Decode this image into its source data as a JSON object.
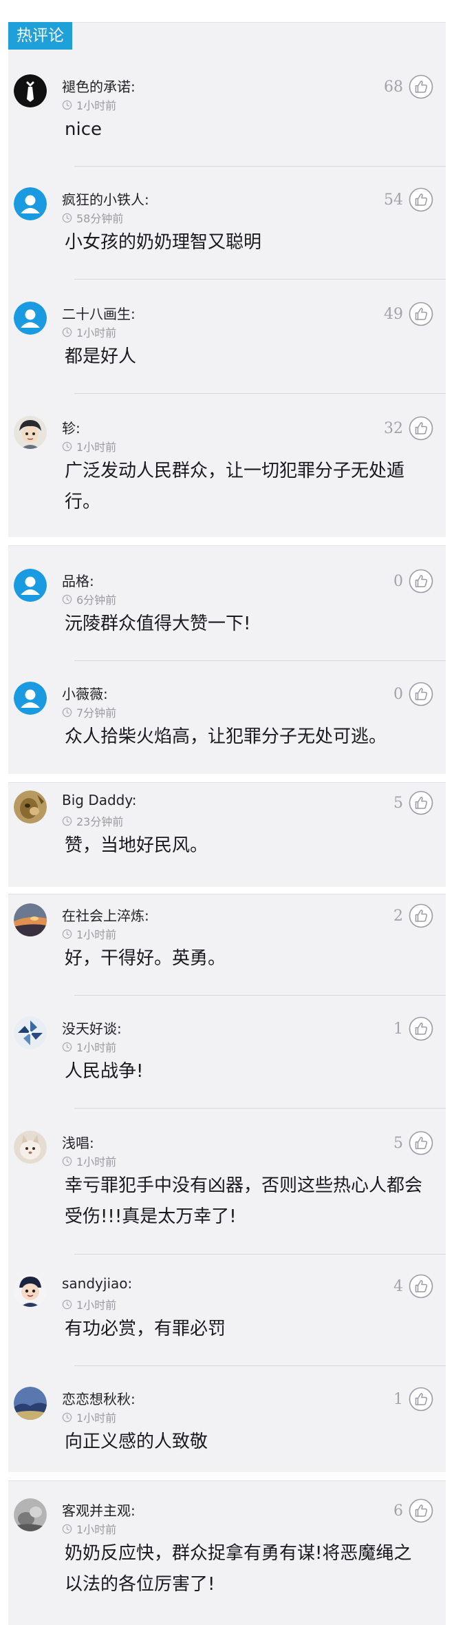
{
  "section": {
    "title": "热评论"
  },
  "comments": [
    {
      "username": "褪色的承诺:",
      "time": "1小时前",
      "likes": "68",
      "content": "nice",
      "avatar": "white-tie-avatar",
      "avatar_color": "#111111"
    },
    {
      "username": "疯狂的小铁人:",
      "time": "58分钟前",
      "likes": "54",
      "content": "小女孩的奶奶理智又聪明",
      "avatar": "default-user-avatar",
      "avatar_color": "#1a9ae0"
    },
    {
      "username": "二十八画生:",
      "time": "1小时前",
      "likes": "49",
      "content": "都是好人",
      "avatar": "default-user-avatar",
      "avatar_color": "#1a9ae0"
    },
    {
      "username": "轸:",
      "time": "1小时前",
      "likes": "32",
      "content": "广泛发动人民群众，让一切犯罪分子无处遁行。",
      "avatar": "cartoon-boy-avatar",
      "avatar_color": "#4a5060"
    },
    {
      "username": "品格:",
      "time": "6分钟前",
      "likes": "0",
      "content": "沅陵群众值得大赞一下!",
      "avatar": "default-user-avatar",
      "avatar_color": "#1a9ae0"
    },
    {
      "username": "小薇薇:",
      "time": "7分钟前",
      "likes": "0",
      "content": "众人拾柴火焰高，让犯罪分子无处可逃。",
      "avatar": "default-user-avatar",
      "avatar_color": "#1a9ae0"
    },
    {
      "username": "Big Daddy:",
      "time": "23分钟前",
      "likes": "5",
      "content": "赞，当地好民风。",
      "avatar": "animal-photo-avatar",
      "avatar_color": "#8a6a30"
    },
    {
      "username": "在社会上淬炼:",
      "time": "1小时前",
      "likes": "2",
      "content": "好，干得好。英勇。",
      "avatar": "sunset-photo-avatar",
      "avatar_color": "#d88040"
    },
    {
      "username": "没天好谈:",
      "time": "1小时前",
      "likes": "1",
      "content": "人民战争!",
      "avatar": "pinwheel-avatar",
      "avatar_color": "#3a6aa0"
    },
    {
      "username": "浅唱:",
      "time": "1小时前",
      "likes": "5",
      "content": "幸亏罪犯手中没有凶器，否则这些热心人都会受伤!!!真是太万幸了!",
      "avatar": "pet-photo-avatar",
      "avatar_color": "#c8b8a8"
    },
    {
      "username": "sandyjiao:",
      "time": "1小时前",
      "likes": "4",
      "content": "有功必赏，有罪必罚",
      "avatar": "cartoon-face-avatar",
      "avatar_color": "#2a3a60"
    },
    {
      "username": "恋恋想秋秋:",
      "time": "1小时前",
      "likes": "1",
      "content": "向正义感的人致敬",
      "avatar": "landscape-photo-avatar",
      "avatar_color": "#2a4070"
    },
    {
      "username": "客观并主观:",
      "time": "1小时前",
      "likes": "6",
      "content": "奶奶反应快，群众捉拿有勇有谋!将恶魔绳之以法的各位厉害了!",
      "avatar": "gray-photo-avatar",
      "avatar_color": "#8a8a8a"
    }
  ]
}
